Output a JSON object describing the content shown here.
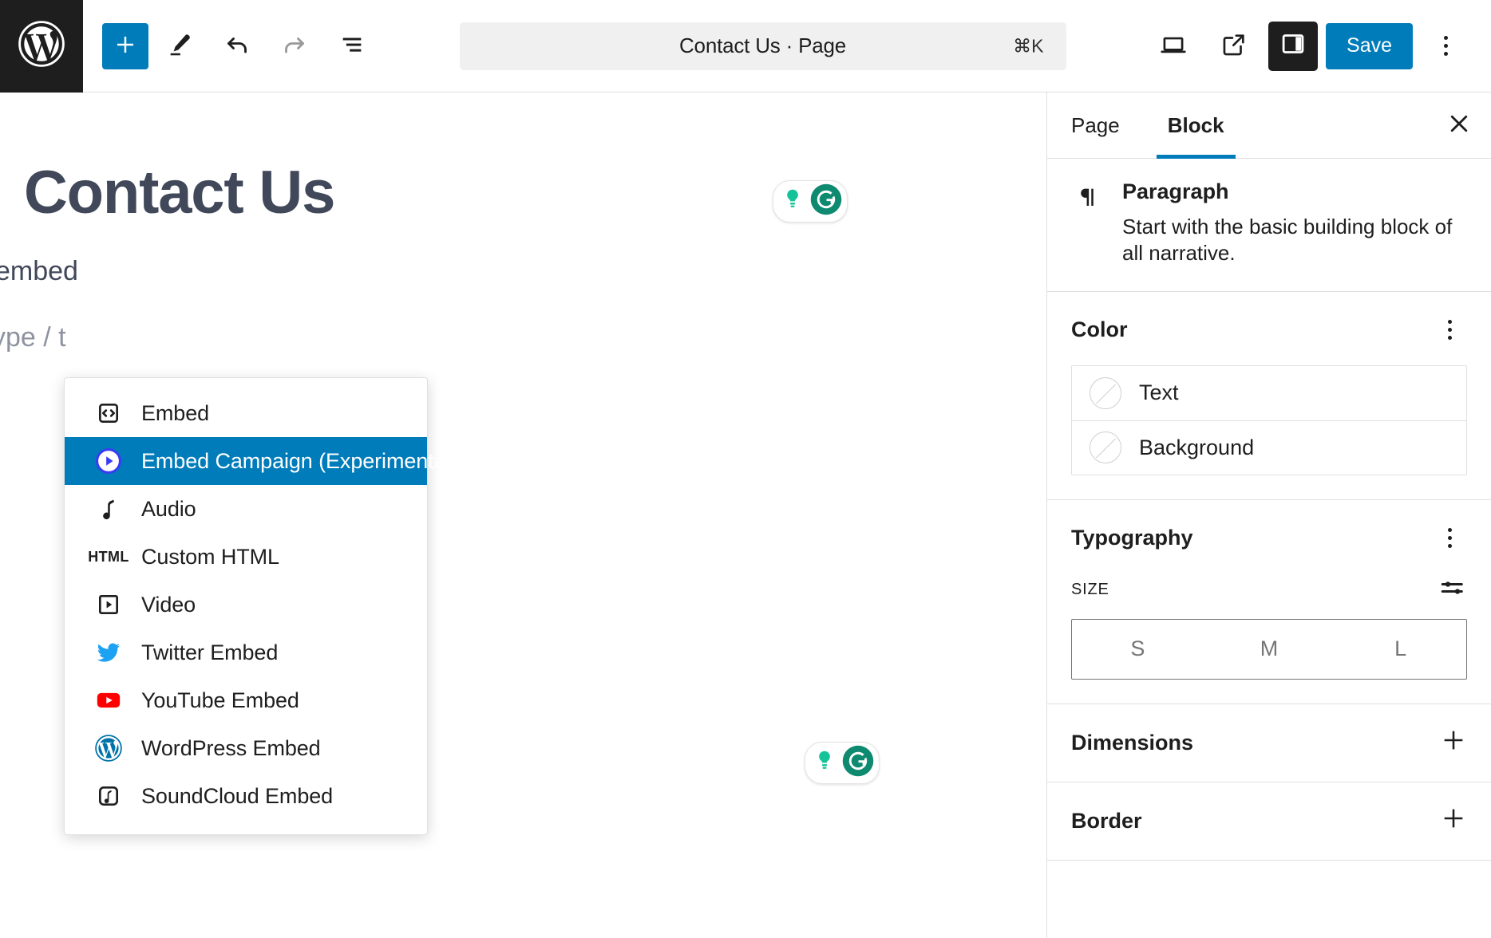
{
  "topbar": {
    "logo_icon": "wordpress-logo-icon",
    "add_block_label": "+",
    "tools": [
      {
        "name": "add-block-button",
        "icon": "plus-icon"
      },
      {
        "name": "edit-tool-button",
        "icon": "pencil-icon"
      },
      {
        "name": "undo-button",
        "icon": "undo-arrow-icon"
      },
      {
        "name": "redo-button",
        "icon": "redo-arrow-icon"
      },
      {
        "name": "list-view-button",
        "icon": "list-view-icon"
      }
    ],
    "document_title": "Contact Us · Page",
    "command_shortcut": "⌘K",
    "view_device_icon": "desktop-icon",
    "view_preview_icon": "external-link-icon",
    "sidebar_toggle_icon": "sidebar-panel-icon",
    "save_label": "Save",
    "options_icon": "kebab-menu-icon"
  },
  "editor": {
    "post_title": "Contact Us",
    "paragraph_text": "embed",
    "placeholder_text": "ype / t",
    "grammarly_badge_icon": "grammarly-icon",
    "grammarly_assistant_icon": "grammarly-assistant-icon"
  },
  "slash_menu": {
    "items": [
      {
        "label": "Embed",
        "icon": "embed-code-icon",
        "selected": false
      },
      {
        "label": "Embed Campaign (Experimental)",
        "icon": "embed-campaign-play-icon",
        "selected": true
      },
      {
        "label": "Audio",
        "icon": "audio-note-icon",
        "selected": false
      },
      {
        "label": "Custom HTML",
        "icon": "html-text-icon",
        "selected": false
      },
      {
        "label": "Video",
        "icon": "video-play-icon",
        "selected": false
      },
      {
        "label": "Twitter Embed",
        "icon": "twitter-bird-icon",
        "selected": false
      },
      {
        "label": "YouTube Embed",
        "icon": "youtube-icon",
        "selected": false
      },
      {
        "label": "WordPress Embed",
        "icon": "wordpress-icon",
        "selected": false
      },
      {
        "label": "SoundCloud Embed",
        "icon": "soundcloud-icon",
        "selected": false
      }
    ]
  },
  "sidebar": {
    "tabs": [
      {
        "label": "Page",
        "active": false
      },
      {
        "label": "Block",
        "active": true
      }
    ],
    "close_icon": "close-icon",
    "block_card": {
      "icon": "paragraph-pilcrow-icon",
      "title": "Paragraph",
      "description": "Start with the basic building block of all narrative."
    },
    "color": {
      "title": "Color",
      "options_icon": "kebab-menu-icon",
      "rows": [
        {
          "label": "Text",
          "swatch_icon": "no-color-swatch-icon"
        },
        {
          "label": "Background",
          "swatch_icon": "no-color-swatch-icon"
        }
      ]
    },
    "typography": {
      "title": "Typography",
      "options_icon": "kebab-menu-icon",
      "size_label": "SIZE",
      "size_settings_icon": "sliders-icon",
      "size_options": [
        "S",
        "M",
        "L"
      ]
    },
    "collapsibles": [
      {
        "label": "Dimensions",
        "toggle_icon": "plus-icon"
      },
      {
        "label": "Border",
        "toggle_icon": "plus-icon"
      }
    ]
  },
  "colors": {
    "accent_blue": "#007cba",
    "dark": "#1e1e1e",
    "title_slate": "#41485a",
    "placeholder_gray": "#8d93a0",
    "twitter_blue": "#1da1f2",
    "youtube_red": "#ff0000",
    "wordpress_blue": "#0073aa",
    "campaign_purple": "#3a3af4",
    "grammarly_green": "#15c39a",
    "grammarly_dark_green": "#0e8a70"
  }
}
